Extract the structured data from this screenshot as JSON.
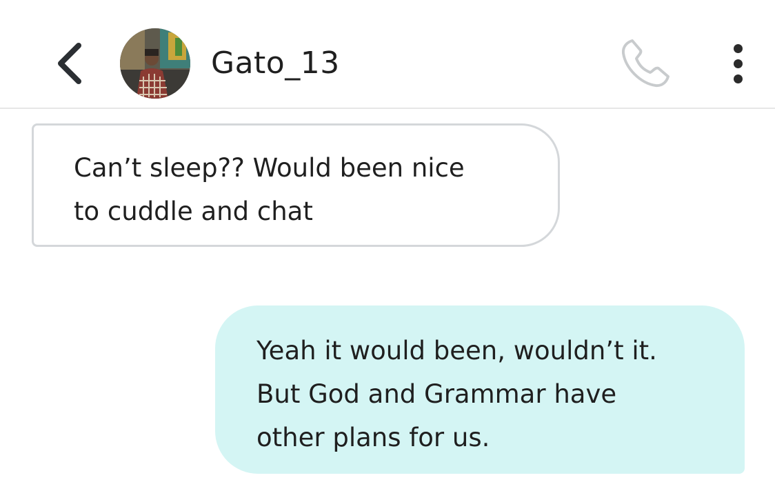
{
  "header": {
    "contact_name": "Gato_13",
    "back_icon": "chevron-left-icon",
    "call_icon": "phone-icon",
    "menu_icon": "more-vertical-icon"
  },
  "messages": [
    {
      "direction": "incoming",
      "text": "Can’t sleep?? Would been nice\nto cuddle and chat"
    },
    {
      "direction": "outgoing",
      "text": "Yeah it would been, wouldn’t it.\nBut God and Grammar have\nother plans for us."
    }
  ],
  "colors": {
    "outgoing_bubble": "#d4f5f4",
    "incoming_border": "#d4d7da",
    "divider": "#e6e6e6"
  }
}
